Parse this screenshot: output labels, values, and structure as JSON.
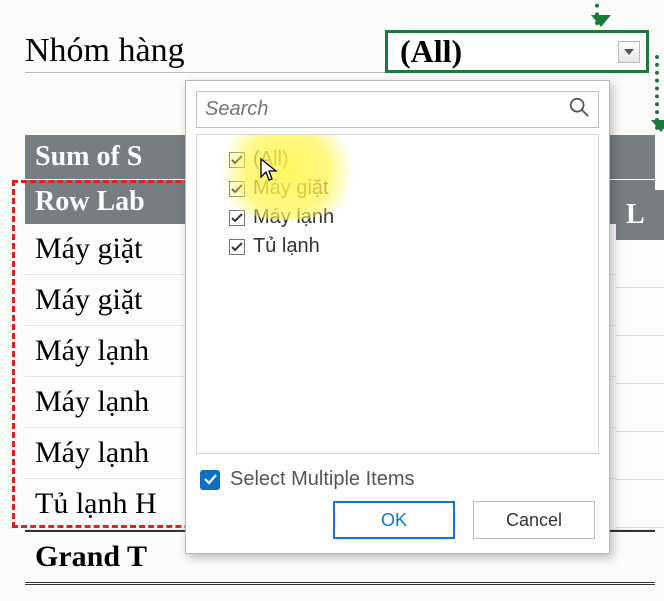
{
  "filter": {
    "label": "Nhóm hàng",
    "value": "(All)"
  },
  "pivot": {
    "sum_header": "Sum of S",
    "row_header": "Row Lab",
    "rows": [
      "Máy giặt ",
      "Máy giặt ",
      "Máy lạnh",
      "Máy lạnh",
      "Máy lạnh",
      "Tủ lạnh H"
    ],
    "total": "Grand T",
    "right_header": "L"
  },
  "dropdown": {
    "search_placeholder": "Search",
    "items": [
      {
        "label": "(All)",
        "checked": true
      },
      {
        "label": "Máy giặt",
        "checked": true
      },
      {
        "label": "Máy lạnh",
        "checked": true
      },
      {
        "label": "Tủ lạnh",
        "checked": true
      }
    ],
    "multi_label": "Select Multiple Items",
    "multi_checked": true,
    "ok": "OK",
    "cancel": "Cancel"
  }
}
